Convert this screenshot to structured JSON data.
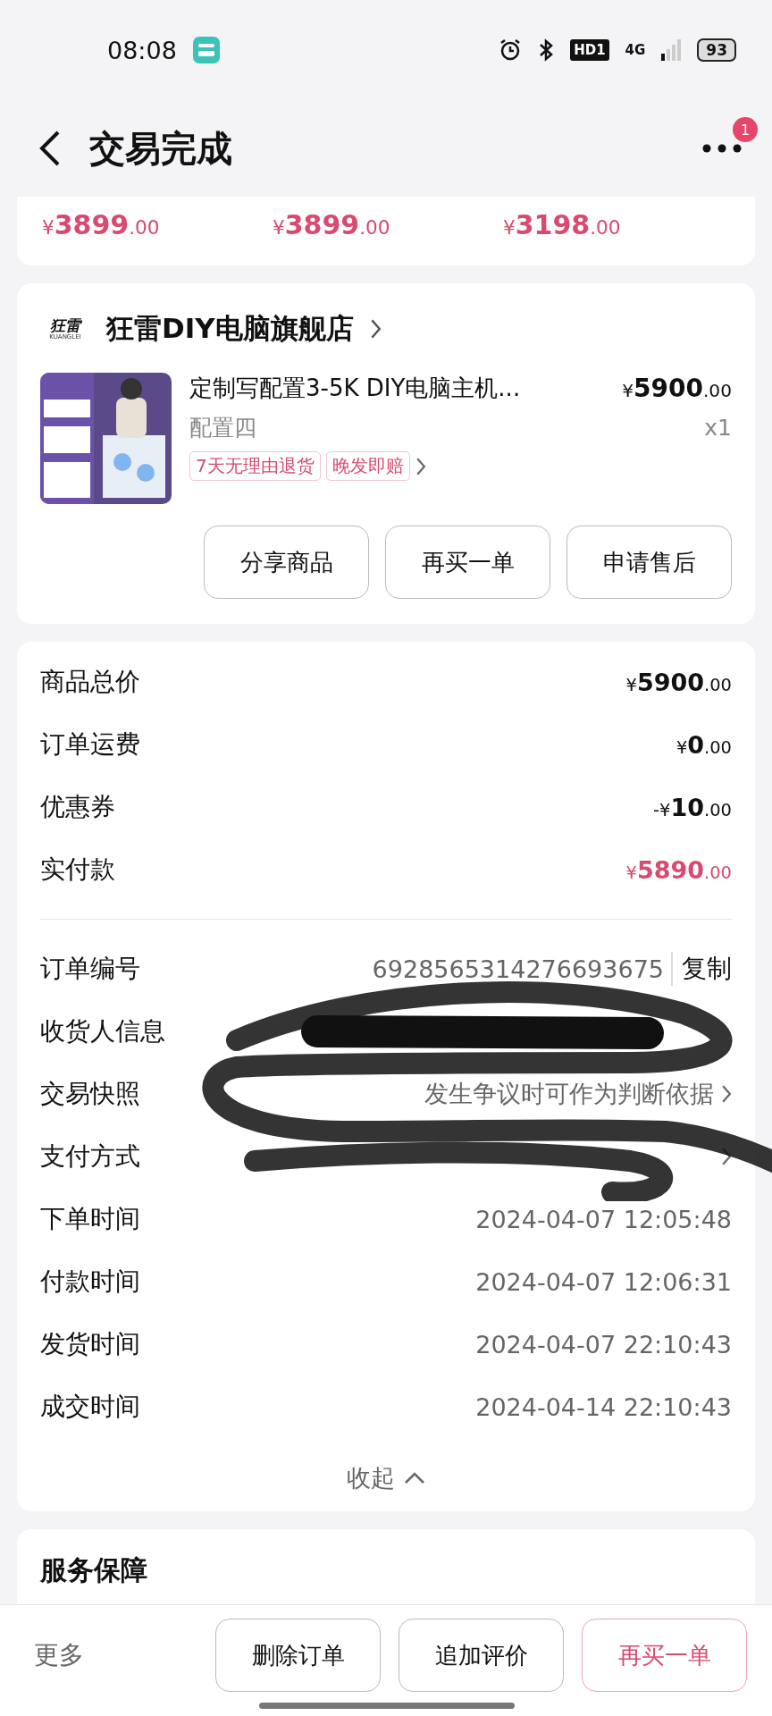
{
  "status_bar": {
    "time": "08:08",
    "hd": "HD1",
    "network": "4G",
    "battery": "93"
  },
  "header": {
    "title": "交易完成",
    "badge": "1"
  },
  "recommendations": [
    {
      "price": "¥3899.00"
    },
    {
      "price": "¥3899.00"
    },
    {
      "price": "¥3198.00"
    }
  ],
  "store": {
    "logo_text": "狂雷",
    "logo_subtext": "KUANGLEI",
    "name": "狂雷DIY电脑旗舰店"
  },
  "product": {
    "title": "定制写配置3-5K DIY电脑主机...",
    "variant": "配置四",
    "price": "¥5900.00",
    "quantity": "x1",
    "tags": [
      "7天无理由退货",
      "晚发即赔"
    ],
    "actions": [
      "分享商品",
      "再买一单",
      "申请售后"
    ]
  },
  "summary": [
    {
      "label": "商品总价",
      "value": "¥5900.00",
      "kind": "normal"
    },
    {
      "label": "订单运费",
      "value": "¥0.00",
      "kind": "normal"
    },
    {
      "label": "优惠券",
      "value": "-¥10.00",
      "kind": "normal"
    },
    {
      "label": "实付款",
      "value": "¥5890.00",
      "kind": "paid"
    }
  ],
  "details": [
    {
      "label": "订单编号",
      "value": "6928565314276693675",
      "kind": "copy",
      "action": "复制"
    },
    {
      "label": "收货人信息",
      "kind": "hidden"
    },
    {
      "label": "交易快照",
      "value": "发生争议时可作为判断依据",
      "kind": "link"
    },
    {
      "label": "支付方式",
      "kind": "link"
    },
    {
      "label": "下单时间",
      "value": "2024-04-07 12:05:48",
      "kind": "text"
    },
    {
      "label": "付款时间",
      "value": "2024-04-07 12:06:31",
      "kind": "text"
    },
    {
      "label": "发货时间",
      "value": "2024-04-07 22:10:43",
      "kind": "text"
    },
    {
      "label": "成交时间",
      "value": "2024-04-14 22:10:43",
      "kind": "text"
    }
  ],
  "collapse": "收起",
  "service": {
    "title": "服务保障"
  },
  "bottom_bar": {
    "more": "更多",
    "buttons": [
      {
        "label": "删除订单",
        "kind": "normal"
      },
      {
        "label": "追加评价",
        "kind": "normal"
      },
      {
        "label": "再买一单",
        "kind": "primary"
      }
    ]
  }
}
